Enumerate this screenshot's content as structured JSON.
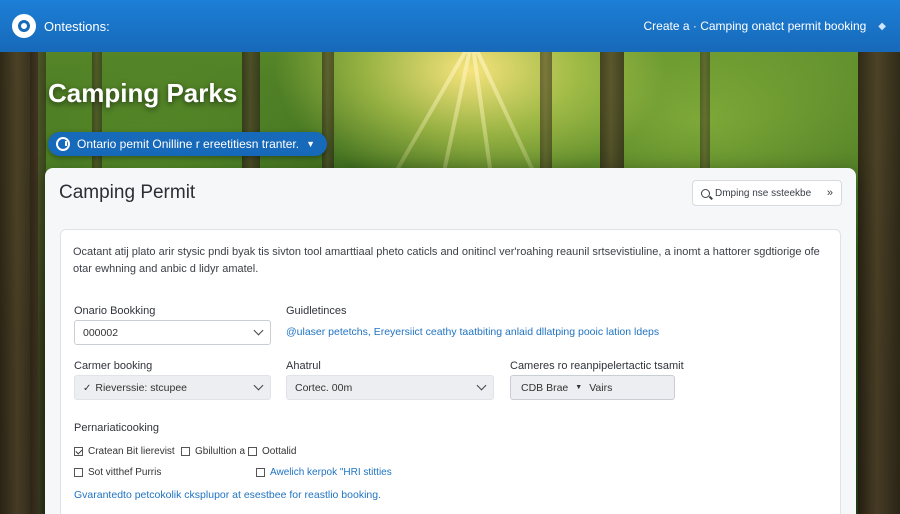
{
  "topbar": {
    "brand": "Ontestions:",
    "action": "Create a · Camping onatct permit booking"
  },
  "hero": {
    "title": "Camping Parks",
    "pill": "Ontario pemit Onilline r ereetitiesn tranter."
  },
  "card": {
    "title": "Camping Permit",
    "search": "Dmping nse ssteekbe",
    "description": "Ocatant atij plato arir stysic pndi byak tis sivton tool amarttiaal pheto caticls and onitincl ver'roahing reaunil srtsevistiuline, a inomt a hattorer sgdtiorige ofe otar ewhning and anbic d lidyr amatel.",
    "booking_label": "Onario Bookking",
    "booking_value": "000002",
    "guidelines_label": "Guidletinces",
    "guidelines_link": "@ulaser petetchs, Ereyersiict ceathy taatbiting anlaid dllatping pooic lation ldeps",
    "camper_label": "Carmer booking",
    "camper_value": "Rieverssie: stcupee",
    "ahatrul_label": "Ahatrul",
    "ahatrul_value": "Cortec. 00m",
    "cameres_label": "Cameres ro reanpipelertactic tsamit",
    "cameres_select": "CDB Brae",
    "cameres_extra": "Vairs",
    "options_label": "Pernariaticooking",
    "options": [
      {
        "label": "Cratean Bit lierevist",
        "checked": true
      },
      {
        "label": "Gbilultion a",
        "checked": false
      },
      {
        "label": "Oottalid",
        "checked": false
      },
      {
        "label": "Sot vitthef Purris",
        "checked": false
      },
      {
        "label": "Awelich kerpok \"HRI stitties",
        "checked": false
      }
    ],
    "footer_link": "Gvarantedto petcokolik cksplupor at esestbee for reastlio booking."
  }
}
